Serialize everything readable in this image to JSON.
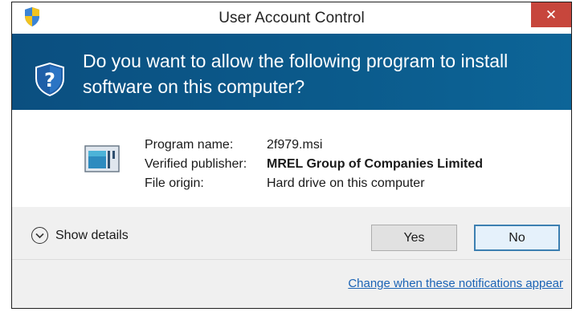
{
  "window": {
    "title": "User Account Control",
    "close_label": "✕",
    "title_icon": "uac-shield-icon"
  },
  "banner": {
    "question": "Do you want to allow the following program to install software on this computer?",
    "icon": "uac-question-shield-icon"
  },
  "program_info": {
    "icon": "installer-program-icon",
    "rows": [
      {
        "label": "Program name:",
        "value": "2f979.msi"
      },
      {
        "label": "Verified publisher:",
        "value": "MREL Group of Companies Limited"
      },
      {
        "label": "File origin:",
        "value": "Hard drive on this computer"
      }
    ]
  },
  "actions": {
    "show_details_label": "Show details",
    "yes_label": "Yes",
    "no_label": "No"
  },
  "footer": {
    "link_text": "Change when these notifications appear"
  },
  "colors": {
    "banner_blue": "#0b5b8c",
    "close_red": "#c7463c",
    "link_blue": "#1b63b5"
  }
}
